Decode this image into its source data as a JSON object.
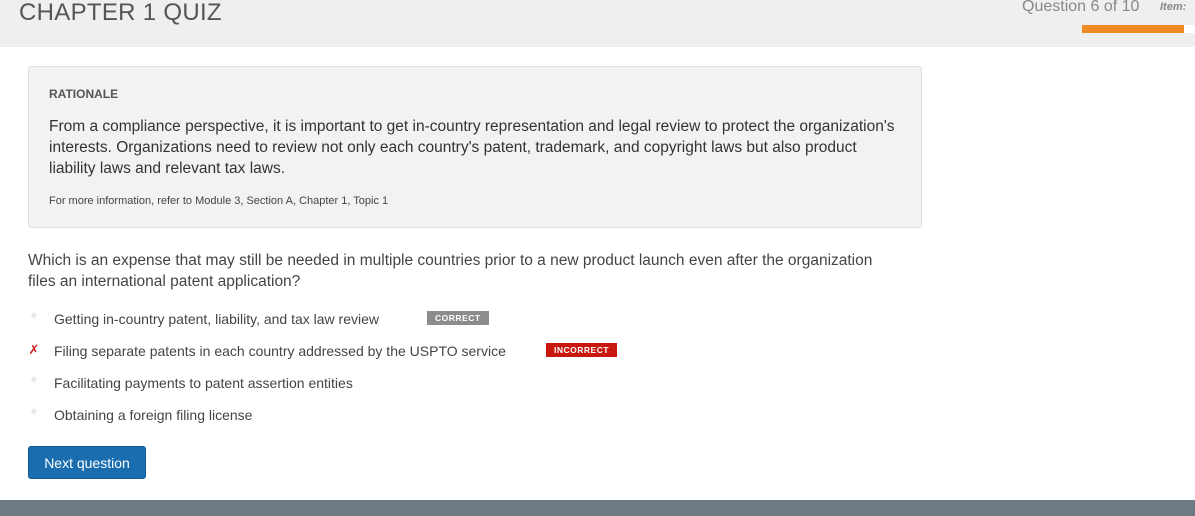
{
  "header": {
    "title": "CHAPTER 1 QUIZ",
    "question_counter": "Question 6 of 10",
    "items_label": "Item:",
    "progress": 0.9,
    "progress_color": "#f08a24"
  },
  "rationale": {
    "heading": "RATIONALE",
    "body": "From a compliance perspective, it is important to get in-country representation and legal review to protect the organization's interests. Organizations need to review not only each country's patent, trademark, and copyright laws but also product liability laws and relevant tax laws.",
    "reference": "For more information, refer to Module 3, Section A, Chapter 1, Topic 1"
  },
  "question": {
    "text": "Which is an expense that may still be needed in multiple countries prior to a new product launch even after the organization files an international patent application?",
    "options": [
      {
        "text": "Getting in-country patent, liability, and tax law review",
        "marker": "✧",
        "badge": "CORRECT"
      },
      {
        "text": "Filing separate patents in each country addressed by the USPTO service",
        "marker": "✗",
        "badge": "INCORRECT"
      },
      {
        "text": "Facilitating payments to patent assertion entities",
        "marker": "✧",
        "badge": ""
      },
      {
        "text": "Obtaining a foreign filing license",
        "marker": "✧",
        "badge": ""
      }
    ]
  },
  "actions": {
    "next_label": "Next question"
  },
  "colors": {
    "correct_badge": "#8c8c8c",
    "incorrect_badge": "#c8170f",
    "primary_button": "#1a6dae",
    "footer": "#6e7a83"
  }
}
